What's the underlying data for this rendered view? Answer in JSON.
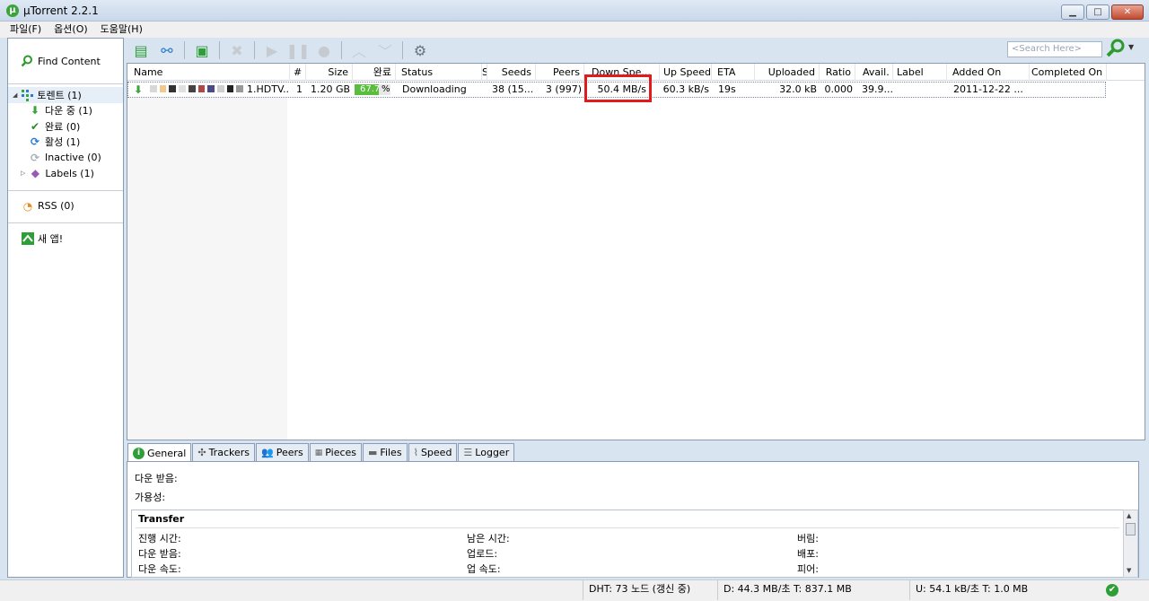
{
  "window": {
    "title": "µTorrent 2.2.1",
    "min": "▁",
    "max": "□",
    "close": "✕"
  },
  "menu": [
    "파일(F)",
    "옵션(O)",
    "도움말(H)"
  ],
  "sidebar": {
    "find_content": "Find Content",
    "torrents": "토렌트 (1)",
    "items": [
      {
        "label": "다운 중 (1)",
        "icon": "download-arrow-icon",
        "color": "#3aa33a"
      },
      {
        "label": "완료 (0)",
        "icon": "checkmark-icon",
        "color": "#2b8a2b"
      },
      {
        "label": "활성 (1)",
        "icon": "refresh-icon",
        "color": "#2a7bd0"
      },
      {
        "label": "Inactive (0)",
        "icon": "inactive-refresh-icon",
        "color": "#a9b0ba"
      },
      {
        "label": "Labels (1)",
        "icon": "label-tag-icon",
        "color": "#9b59b6"
      }
    ],
    "rss": "RSS (0)",
    "apps": "새 앱!"
  },
  "toolbar": {
    "search_placeholder": "<Search Here>",
    "buttons": [
      "add-torrent",
      "add-url",
      "create-torrent",
      "remove",
      "start",
      "pause",
      "stop",
      "move-up",
      "move-down",
      "preferences"
    ]
  },
  "columns": [
    "Name",
    "#",
    "Size",
    "완료",
    "Status",
    "S",
    "Seeds",
    "Peers",
    "Down Spe...",
    "Up Speed",
    "ETA",
    "Uploaded",
    "Ratio",
    "Avail.",
    "Label",
    "Added On",
    "Completed On"
  ],
  "torrent": {
    "name_suffix": "1.HDTV....",
    "num": "1",
    "size": "1.20 GB",
    "percent_text": "67.7",
    "percent_sign": "%",
    "progress": 0.677,
    "status": "Downloading",
    "seeds": "38 (15...",
    "peers": "3 (997)",
    "down_speed": "50.4 MB/s",
    "up_speed": "60.3 kB/s",
    "eta": "19s",
    "uploaded": "32.0 kB",
    "ratio": "0.000",
    "avail": "39.9...",
    "label": "",
    "added_on": "2011-12-22 ...",
    "completed_on": ""
  },
  "tabs": [
    "General",
    "Trackers",
    "Peers",
    "Pieces",
    "Files",
    "Speed",
    "Logger"
  ],
  "details": {
    "downloaded": "다운 받음:",
    "availability": "가용성:",
    "transfer_title": "Transfer",
    "col1": [
      "진행 시간:",
      "다운 받음:",
      "다운 속도:"
    ],
    "col2": [
      "남은 시간:",
      "업로드:",
      "업 속도:"
    ],
    "col3": [
      "버림:",
      "배포:",
      "피어:"
    ]
  },
  "status": {
    "dht": "DHT: 73 노드  (갱신 중)",
    "down": "D: 44.3 MB/초 T: 837.1 MB",
    "up": "U: 54.1 kB/초 T: 1.0 MB"
  }
}
